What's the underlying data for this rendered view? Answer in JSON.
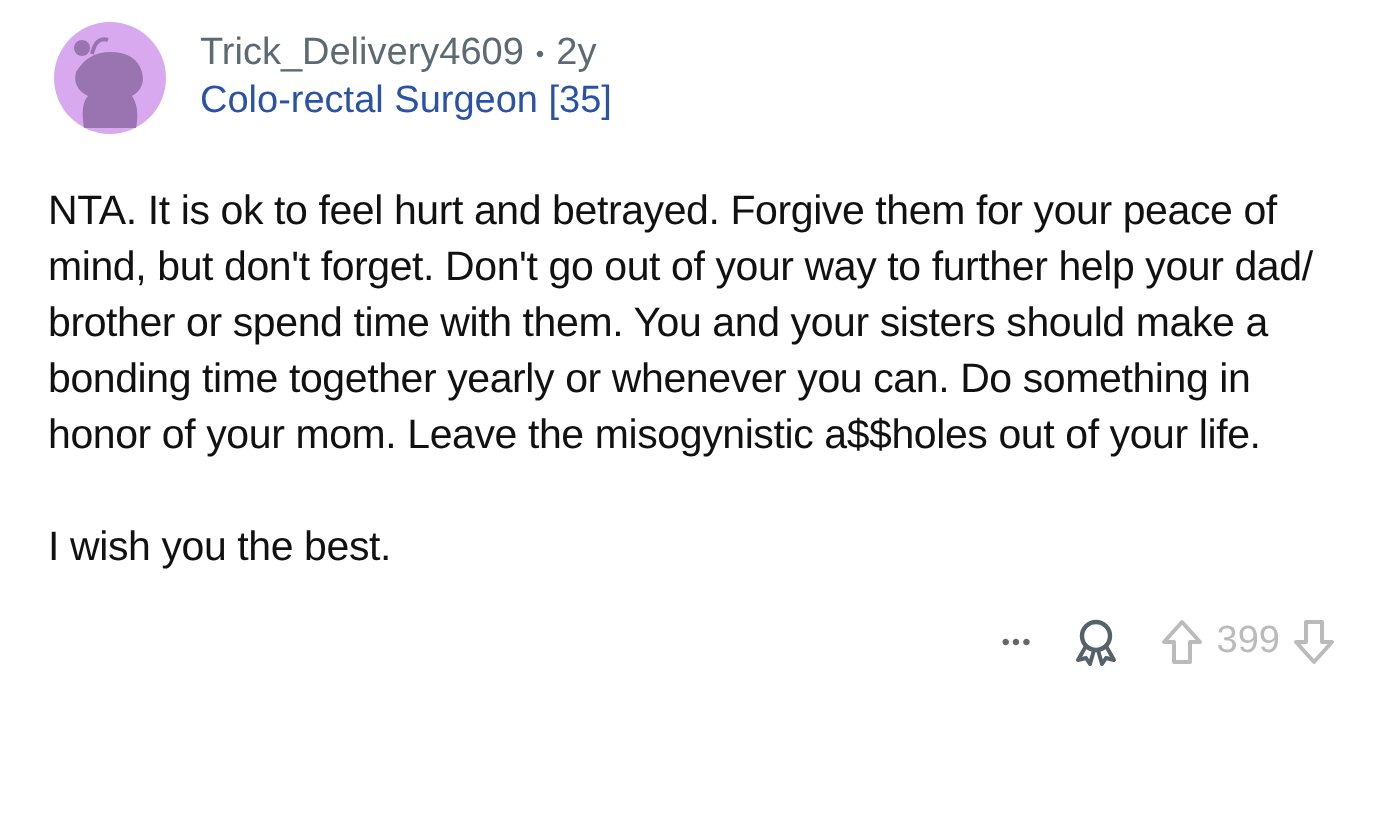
{
  "comment": {
    "author": "Trick_Delivery4609",
    "separator": "•",
    "age": "2y",
    "flair": "Colo-rectal Surgeon [35]",
    "paragraphs": [
      "NTA. It is ok to feel hurt and betrayed. Forgive them for your peace of mind, but don't forget. Don't go out of your way to further help your dad/ brother or spend time with them. You and your sisters should make a bonding time together yearly or whenever you can. Do something in honor of your mom. Leave the misogynistic a$$holes out of your life.",
      "I wish you the best."
    ],
    "more": "•••",
    "score": "399"
  }
}
